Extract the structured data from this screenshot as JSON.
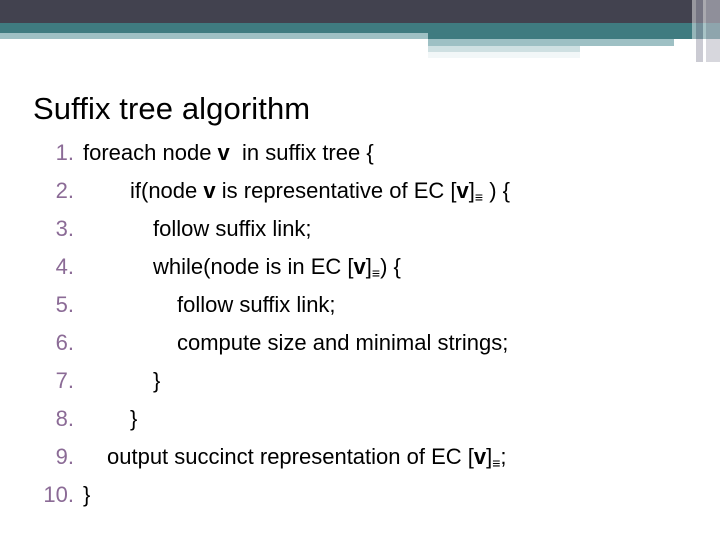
{
  "slide": {
    "title": "Suffix tree algorithm"
  },
  "header": {
    "colors": {
      "dark_band": "#42424F",
      "teal_band": "#3F7B80",
      "pale_band": "#9EC0C4",
      "faint_band": "#CFE0E2"
    }
  },
  "colors": {
    "number": "#8B6B96",
    "text": "#000000",
    "background": "#ffffff"
  },
  "code": {
    "lines": [
      {
        "number": "1.",
        "indent": "ind0",
        "parts": [
          {
            "t": "foreach node ",
            "style": "plain"
          },
          {
            "t": "v",
            "style": "var"
          },
          {
            "t": "  in suffix tree {",
            "style": "plain"
          }
        ]
      },
      {
        "number": "2.",
        "indent": "ind1",
        "parts": [
          {
            "t": "if(node ",
            "style": "plain"
          },
          {
            "t": "v",
            "style": "var"
          },
          {
            "t": " is representative of EC [",
            "style": "plain"
          },
          {
            "t": "v",
            "style": "var"
          },
          {
            "t": "]",
            "style": "plain"
          },
          {
            "t": "≡",
            "style": "sub"
          },
          {
            "t": " ) {",
            "style": "plain"
          }
        ]
      },
      {
        "number": "3.",
        "indent": "ind2",
        "parts": [
          {
            "t": "follow suffix link;",
            "style": "plain"
          }
        ]
      },
      {
        "number": "4.",
        "indent": "ind2",
        "parts": [
          {
            "t": "while(node is in EC [",
            "style": "plain"
          },
          {
            "t": "v",
            "style": "var"
          },
          {
            "t": "]",
            "style": "plain"
          },
          {
            "t": "≡",
            "style": "sub"
          },
          {
            "t": ") {",
            "style": "plain"
          }
        ]
      },
      {
        "number": "5.",
        "indent": "ind3",
        "parts": [
          {
            "t": "follow suffix link;",
            "style": "plain"
          }
        ]
      },
      {
        "number": "6.",
        "indent": "ind3",
        "parts": [
          {
            "t": "compute size and minimal strings;",
            "style": "plain"
          }
        ]
      },
      {
        "number": "7.",
        "indent": "ind2",
        "parts": [
          {
            "t": "}",
            "style": "plain"
          }
        ]
      },
      {
        "number": "8.",
        "indent": "ind1",
        "parts": [
          {
            "t": "}",
            "style": "plain"
          }
        ]
      },
      {
        "number": "9.",
        "indent": "ind4",
        "parts": [
          {
            "t": "output succinct representation of EC [",
            "style": "plain"
          },
          {
            "t": "v",
            "style": "var"
          },
          {
            "t": "]",
            "style": "plain"
          },
          {
            "t": "≡",
            "style": "sub"
          },
          {
            "t": ";",
            "style": "plain"
          }
        ]
      },
      {
        "number": "10.",
        "indent": "ind0",
        "parts": [
          {
            "t": "}",
            "style": "plain"
          }
        ]
      }
    ]
  }
}
